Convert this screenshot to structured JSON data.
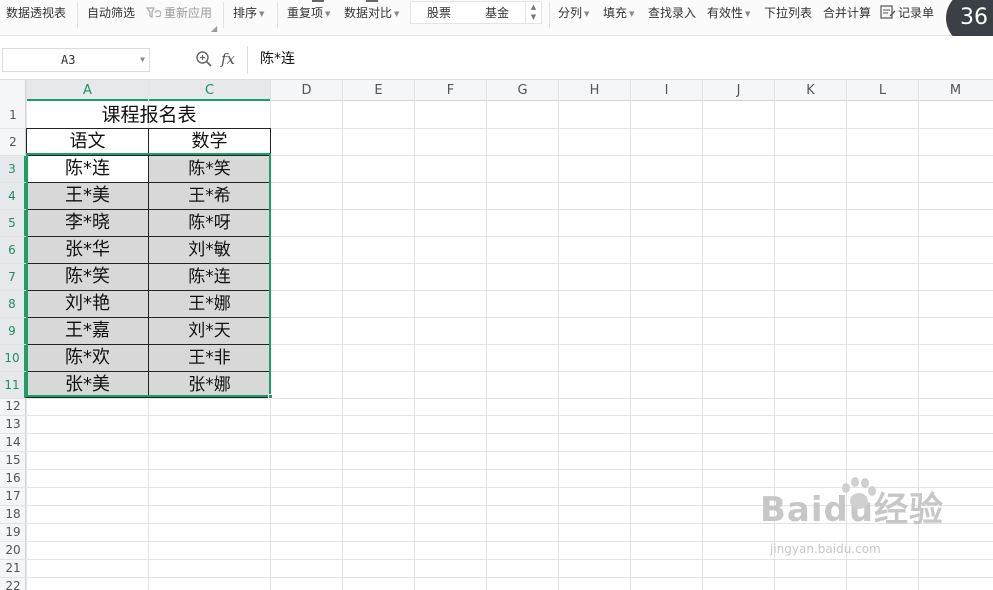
{
  "toolbar": {
    "pivot": "数据透视表",
    "autofilter": "自动筛选",
    "reapply": "重新应用",
    "sort": "排序",
    "duplicates": "重复项",
    "compare": "数据对比",
    "stock": "股票",
    "fund": "基金",
    "split": "分列",
    "fill": "填充",
    "lookup": "查找录入",
    "validity": "有效性",
    "dropdown": "下拉列表",
    "consolidate": "合并计算",
    "record": "记录单",
    "badge": "36"
  },
  "formula_bar": {
    "cell_ref": "A3",
    "fx": "fx",
    "content": "陈*连"
  },
  "columns": [
    "A",
    "C",
    "D",
    "E",
    "F",
    "G",
    "H",
    "I",
    "J",
    "K",
    "L",
    "M"
  ],
  "rows": [
    "1",
    "2",
    "3",
    "4",
    "5",
    "6",
    "7",
    "8",
    "9",
    "10",
    "11",
    "12",
    "13",
    "14",
    "15",
    "16",
    "17",
    "18",
    "19",
    "20",
    "21",
    "22"
  ],
  "sheet": {
    "title": "课程报名表",
    "headers": [
      "语文",
      "数学"
    ],
    "data": [
      [
        "陈*连",
        "陈*笑"
      ],
      [
        "王*美",
        "王*希"
      ],
      [
        "李*晓",
        "陈*呀"
      ],
      [
        "张*华",
        "刘*敏"
      ],
      [
        "陈*笑",
        "陈*连"
      ],
      [
        "刘*艳",
        "王*娜"
      ],
      [
        "王*嘉",
        "刘*天"
      ],
      [
        "陈*欢",
        "王*非"
      ],
      [
        "张*美",
        "张*娜"
      ]
    ]
  },
  "watermark": {
    "logo": "Baidu经验",
    "url": "jingyan.baidu.com"
  },
  "colors": {
    "selection": "#1d9e68",
    "highlight_fill": "#d8d8d8"
  }
}
